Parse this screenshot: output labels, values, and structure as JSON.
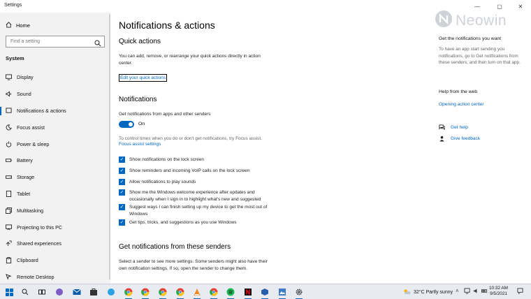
{
  "window": {
    "title": "Settings",
    "minimize": "—",
    "maximize": "▢",
    "close": "✕"
  },
  "sidebar": {
    "home_label": "Home",
    "search_placeholder": "Find a setting",
    "section_label": "System",
    "items": [
      {
        "label": "Display",
        "icon": "monitor-icon"
      },
      {
        "label": "Sound",
        "icon": "speaker-icon"
      },
      {
        "label": "Notifications & actions",
        "icon": "notification-icon",
        "active": true
      },
      {
        "label": "Focus assist",
        "icon": "moon-icon"
      },
      {
        "label": "Power & sleep",
        "icon": "power-icon"
      },
      {
        "label": "Battery",
        "icon": "battery-icon"
      },
      {
        "label": "Storage",
        "icon": "storage-icon"
      },
      {
        "label": "Tablet",
        "icon": "tablet-icon"
      },
      {
        "label": "Multitasking",
        "icon": "multitasking-icon"
      },
      {
        "label": "Projecting to this PC",
        "icon": "projecting-icon"
      },
      {
        "label": "Shared experiences",
        "icon": "shared-icon"
      },
      {
        "label": "Clipboard",
        "icon": "clipboard-icon"
      },
      {
        "label": "Remote Desktop",
        "icon": "remote-desktop-icon"
      }
    ]
  },
  "main": {
    "title": "Notifications & actions",
    "quick_actions": {
      "heading": "Quick actions",
      "description": "You can add, remove, or rearrange your quick actions directly in action center.",
      "link": "Edit your quick actions"
    },
    "notifications": {
      "heading": "Notifications",
      "get_label": "Get notifications from apps and other senders",
      "toggle_state": "On",
      "focus_text": "To control times when you do or don't get notifications, try Focus assist.",
      "focus_link": "Focus assist settings",
      "checkboxes": [
        {
          "label": "Show notifications on the lock screen",
          "checked": true
        },
        {
          "label": "Show reminders and incoming VoIP calls on the lock screen",
          "checked": true
        },
        {
          "label": "Allow notifications to play sounds",
          "checked": true
        },
        {
          "label": "Show me the Windows welcome experience after updates and occasionally when I sign in to highlight what's new and suggested",
          "checked": true
        },
        {
          "label": "Suggest ways I can finish setting up my device to get the most out of Windows",
          "checked": true
        },
        {
          "label": "Get tips, tricks, and suggestions as you use Windows",
          "checked": true
        }
      ]
    },
    "senders": {
      "heading": "Get notifications from these senders",
      "description": "Select a sender to see more settings. Some senders might also have their own notification settings. If so, open the sender to change them."
    }
  },
  "right": {
    "logo_text": "Neowin",
    "get_heading": "Get the notifications you want",
    "get_text": "To have an app start sending you notifications, go to Get notifications from these senders, and then turn on that app.",
    "help_heading": "Help from the web",
    "help_link": "Opening action center",
    "get_help": "Get help",
    "give_feedback": "Give feedback"
  },
  "taskbar": {
    "weather": "32°C  Partly sunny",
    "time": "10:32 AM",
    "date": "9/5/2021"
  },
  "colors": {
    "accent": "#0067c0",
    "sidebar_bg": "#f2f2f2",
    "taskbar_bg": "#e8ecf2"
  }
}
